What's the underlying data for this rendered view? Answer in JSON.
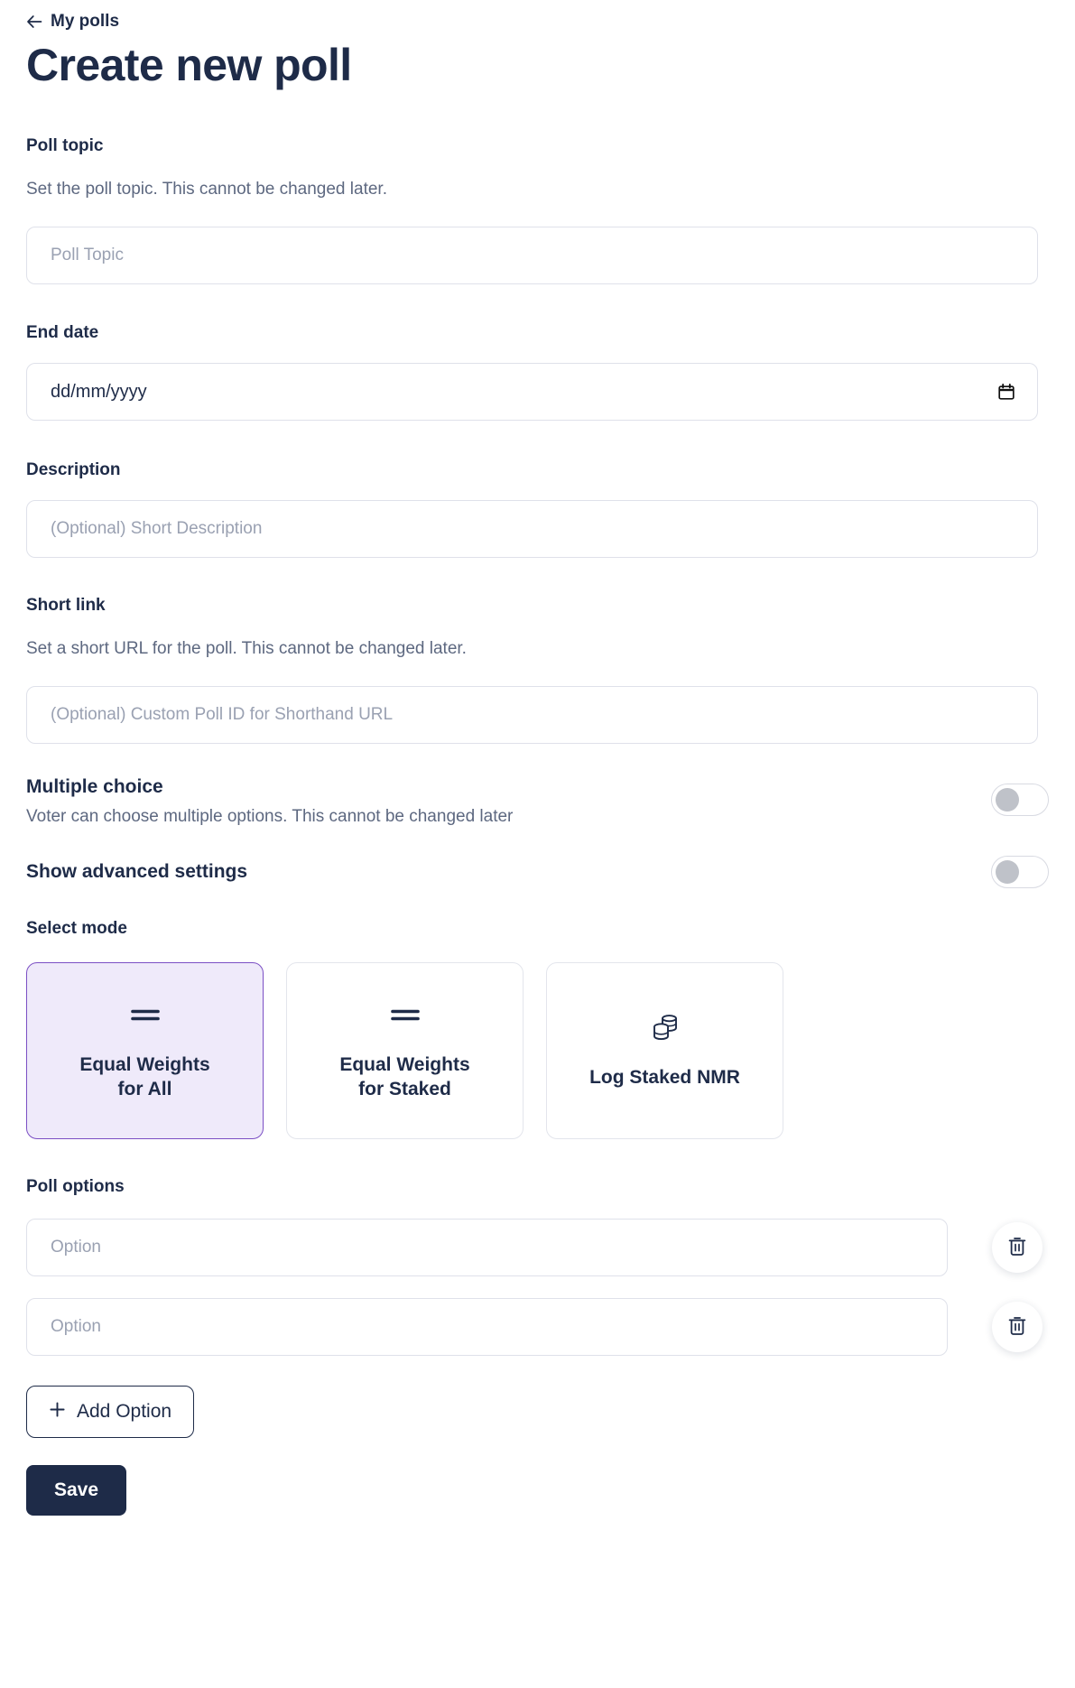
{
  "header": {
    "back_label": "My polls",
    "back_icon": "arrow-left-icon",
    "title": "Create new poll"
  },
  "fields": {
    "poll_topic": {
      "label": "Poll topic",
      "help": "Set the poll topic. This cannot be changed later.",
      "placeholder": "Poll Topic",
      "value": ""
    },
    "end_date": {
      "label": "End date",
      "value": "dd/mm/yyyy",
      "icon": "calendar-icon"
    },
    "description": {
      "label": "Description",
      "placeholder": "(Optional) Short Description",
      "value": ""
    },
    "short_link": {
      "label": "Short link",
      "help": "Set a short URL for the poll. This cannot be changed later.",
      "placeholder": "(Optional) Custom Poll ID for Shorthand URL",
      "value": ""
    }
  },
  "toggles": [
    {
      "title": "Multiple choice",
      "subtitle": "Voter can choose multiple options. This cannot be changed later",
      "state": "off"
    },
    {
      "title": "Show advanced settings",
      "subtitle": "",
      "state": "off"
    }
  ],
  "select_mode": {
    "label": "Select mode",
    "selected_index": 0,
    "cards": [
      {
        "label": "Equal Weights\nfor All",
        "icon": "equals-icon",
        "selected": true
      },
      {
        "label": "Equal Weights\nfor Staked",
        "icon": "equals-icon",
        "selected": false
      },
      {
        "label": "Log Staked NMR",
        "icon": "coins-stack-icon",
        "selected": false
      }
    ]
  },
  "poll_options": {
    "label": "Poll options",
    "options": [
      {
        "placeholder": "Option",
        "value": "",
        "delete_icon": "trash-icon"
      },
      {
        "placeholder": "Option",
        "value": "",
        "delete_icon": "trash-icon"
      }
    ],
    "add_label": "Add Option",
    "add_icon": "plus-icon"
  },
  "actions": {
    "save_label": "Save"
  },
  "colors": {
    "ink": "#1e2b48",
    "muted": "#5d6880",
    "placeholder": "#9aa1b2",
    "border": "#dfe1ea",
    "accent": "#7b4fc4",
    "accent_bg": "#efeafa",
    "toggle_knob": "#bfc2c9"
  }
}
